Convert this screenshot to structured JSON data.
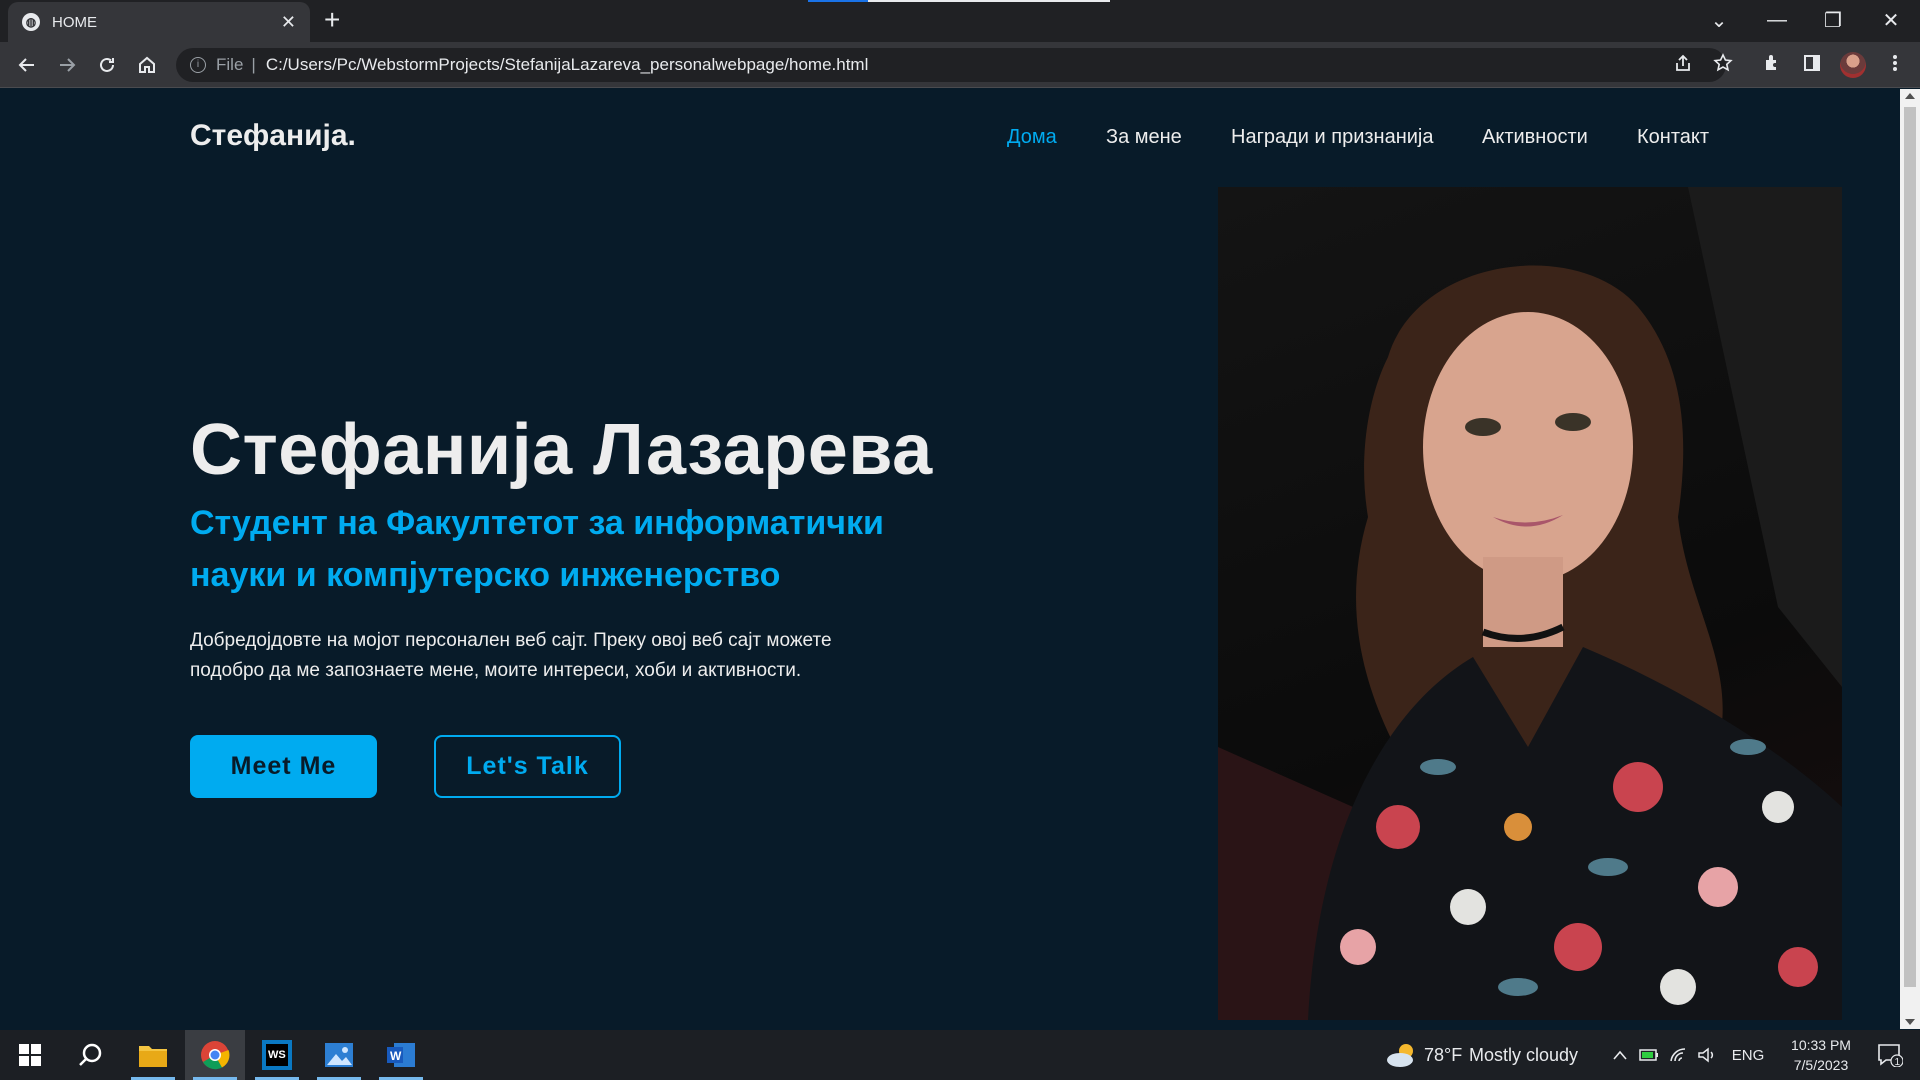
{
  "browser": {
    "tab_title": "HOME",
    "tab_close": "✕",
    "new_tab": "+",
    "address": {
      "info_icon": "i",
      "scheme_label": "File",
      "separator": "|",
      "url": "C:/Users/Pc/WebstormProjects/StefanijaLazareva_personalwebpage/home.html"
    },
    "window_controls": [
      "⌄",
      "—",
      "❐",
      "✕"
    ]
  },
  "site": {
    "logo": "Стефанија.",
    "nav": [
      "Дома",
      "За мене",
      "Награди и признанија",
      "Активности",
      "Контакт"
    ],
    "active_nav_index": 0,
    "hero": {
      "name": "Стефанија Лазарева",
      "subtitle": "Студент на Факултетот за информатички науки и компјутерско инженерство",
      "intro": "Добредојдовте на мојот персонален веб сајт. Преку овој веб сајт можете подобро да ме запознаете мене, моите интереси, хоби и активности.",
      "buttons": {
        "primary": "Meet Me",
        "secondary": "Let's Talk"
      }
    },
    "colors": {
      "background": "#081b29",
      "accent": "#00abf0",
      "text": "#ededed"
    }
  },
  "taskbar": {
    "apps": [
      "windows-start",
      "search",
      "file-explorer",
      "chrome",
      "webstorm",
      "photos",
      "word"
    ],
    "webstorm_label": "WS",
    "word_label": "W",
    "weather": {
      "temperature": "78°F",
      "condition": "Mostly cloudy"
    },
    "language": "ENG",
    "time": "10:33 PM",
    "date": "7/5/2023",
    "notification_count": "1"
  }
}
